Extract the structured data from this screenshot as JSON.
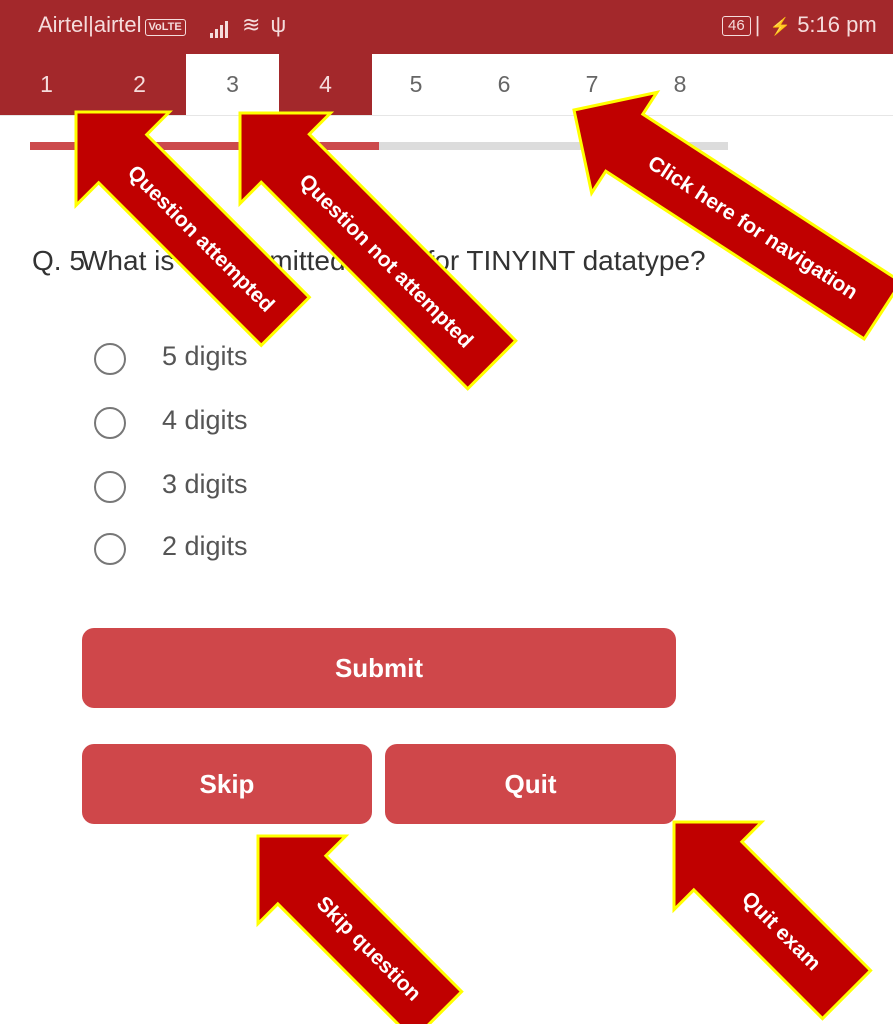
{
  "status_bar": {
    "carrier": "Airtel|airtel",
    "volte": "VoLTE",
    "battery": "46",
    "time": "5:16 pm"
  },
  "nav": {
    "tabs": [
      {
        "label": "1",
        "state": "attempted"
      },
      {
        "label": "2",
        "state": "attempted"
      },
      {
        "label": "3",
        "state": "current"
      },
      {
        "label": "4",
        "state": "attempted"
      },
      {
        "label": "5",
        "state": "not-attempted"
      },
      {
        "label": "6",
        "state": "not-attempted"
      },
      {
        "label": "7",
        "state": "not-attempted"
      },
      {
        "label": "8",
        "state": "not-attempted"
      }
    ]
  },
  "progress": {
    "fraction": 0.5
  },
  "question": {
    "number": "Q. 5",
    "text": "What is the permitted width for TINYINT datatype?",
    "options": [
      "5 digits",
      "4 digits",
      "3 digits",
      "2 digits"
    ]
  },
  "buttons": {
    "submit": "Submit",
    "skip": "Skip",
    "quit": "Quit"
  },
  "annotations": {
    "question_attempted": "Question attempted",
    "question_not_attempted": "Question not attempted",
    "click_here_for_navigation": "Click here for navigation",
    "skip_question": "Skip question",
    "quit_exam": "Quit exam"
  },
  "colors": {
    "primary_dark": "#a3282b",
    "button_red": "#cf474a",
    "annotation_fill": "#c00000",
    "annotation_border": "#ffff00"
  }
}
